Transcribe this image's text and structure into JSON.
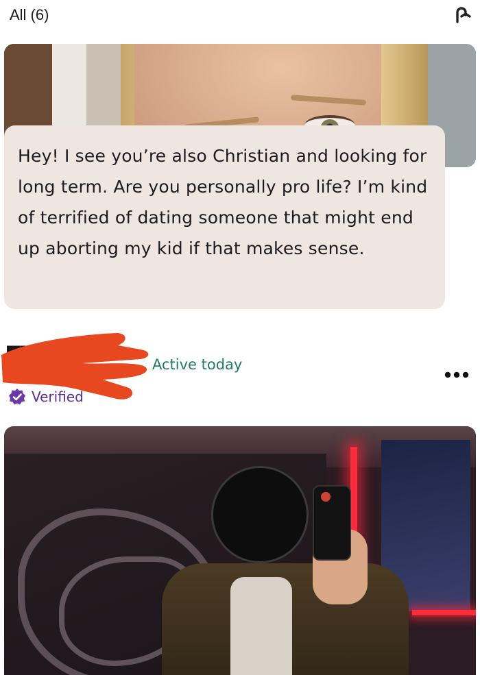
{
  "header": {
    "filter_label": "All (6)",
    "undo_icon": "undo-arrow-icon"
  },
  "comment": {
    "text": "Hey! I see you’re also Christian and looking for long term. Are you personally pro life? I’m kind of terrified of dating someone that might end up aborting my kid if that makes sense."
  },
  "profile": {
    "name": "█████",
    "status": "Active today",
    "verified_label": "Verified",
    "more_icon": "more-dots-icon",
    "verified_icon": "verified-badge-icon"
  },
  "colors": {
    "status_green": "#1f7a66",
    "verified_purple": "#5e2b94",
    "comment_bg": "#efe6e1",
    "redaction_red": "#e8481f"
  }
}
